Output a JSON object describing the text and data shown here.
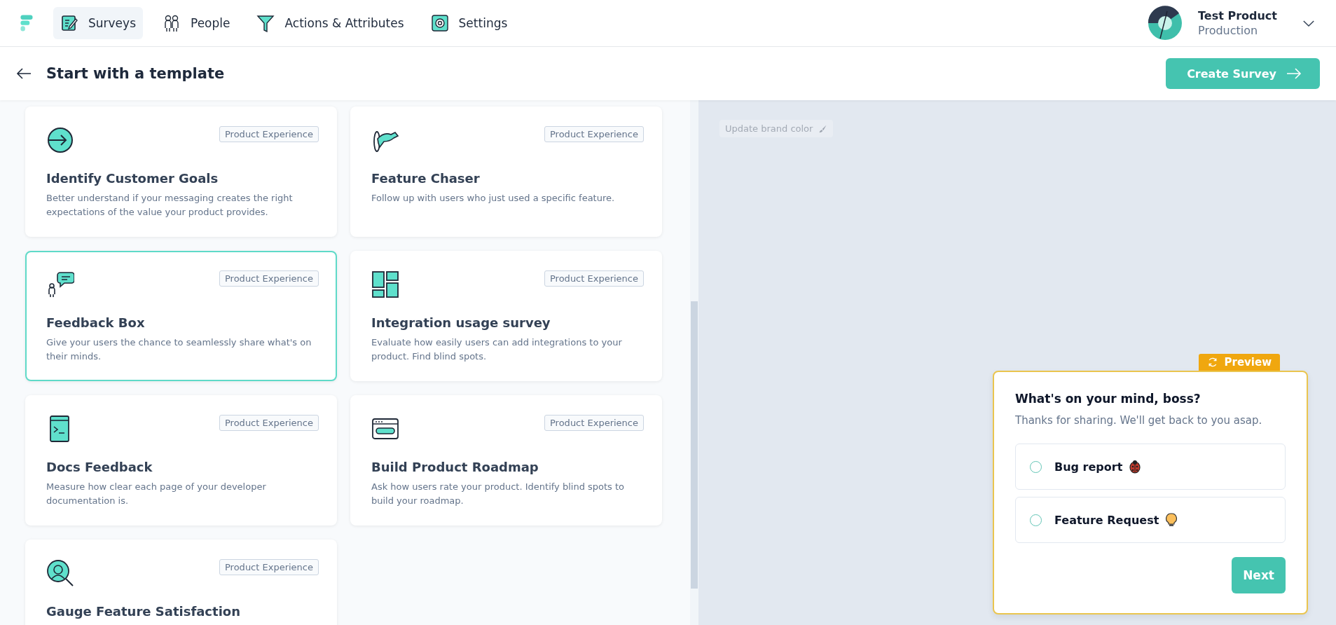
{
  "nav": {
    "items": [
      {
        "label": "Surveys",
        "selected": true
      },
      {
        "label": "People",
        "selected": false
      },
      {
        "label": "Actions & Attributes",
        "selected": false
      },
      {
        "label": "Settings",
        "selected": false
      }
    ],
    "product": {
      "name": "Test Product",
      "environment": "Production"
    }
  },
  "header": {
    "title": "Start with a template",
    "create_button": "Create Survey"
  },
  "templates": [
    {
      "title": "Identify Customer Goals",
      "description": "Better understand if your messaging creates the right expectations of the value your product provides.",
      "tag": "Product Experience",
      "selected": false
    },
    {
      "title": "Feature Chaser",
      "description": "Follow up with users who just used a specific feature.",
      "tag": "Product Experience",
      "selected": false
    },
    {
      "title": "Feedback Box",
      "description": "Give your users the chance to seamlessly share what's on their minds.",
      "tag": "Product Experience",
      "selected": true
    },
    {
      "title": "Integration usage survey",
      "description": "Evaluate how easily users can add integrations to your product. Find blind spots.",
      "tag": "Product Experience",
      "selected": false
    },
    {
      "title": "Docs Feedback",
      "description": "Measure how clear each page of your developer documentation is.",
      "tag": "Product Experience",
      "selected": false
    },
    {
      "title": "Build Product Roadmap",
      "description": "Ask how users rate your product. Identify blind spots to build your roadmap.",
      "tag": "Product Experience",
      "selected": false
    },
    {
      "title": "Gauge Feature Satisfaction",
      "tag": "Product Experience",
      "selected": false
    }
  ],
  "preview": {
    "brand_button": "Update brand color",
    "tab": "Preview",
    "question": "What's on your mind, boss?",
    "subheader": "Thanks for sharing. We'll get back to you asap.",
    "choices": [
      {
        "label": "Bug report",
        "selected": false
      },
      {
        "label": "Feature Request",
        "selected": false
      }
    ],
    "next_button": "Next"
  }
}
